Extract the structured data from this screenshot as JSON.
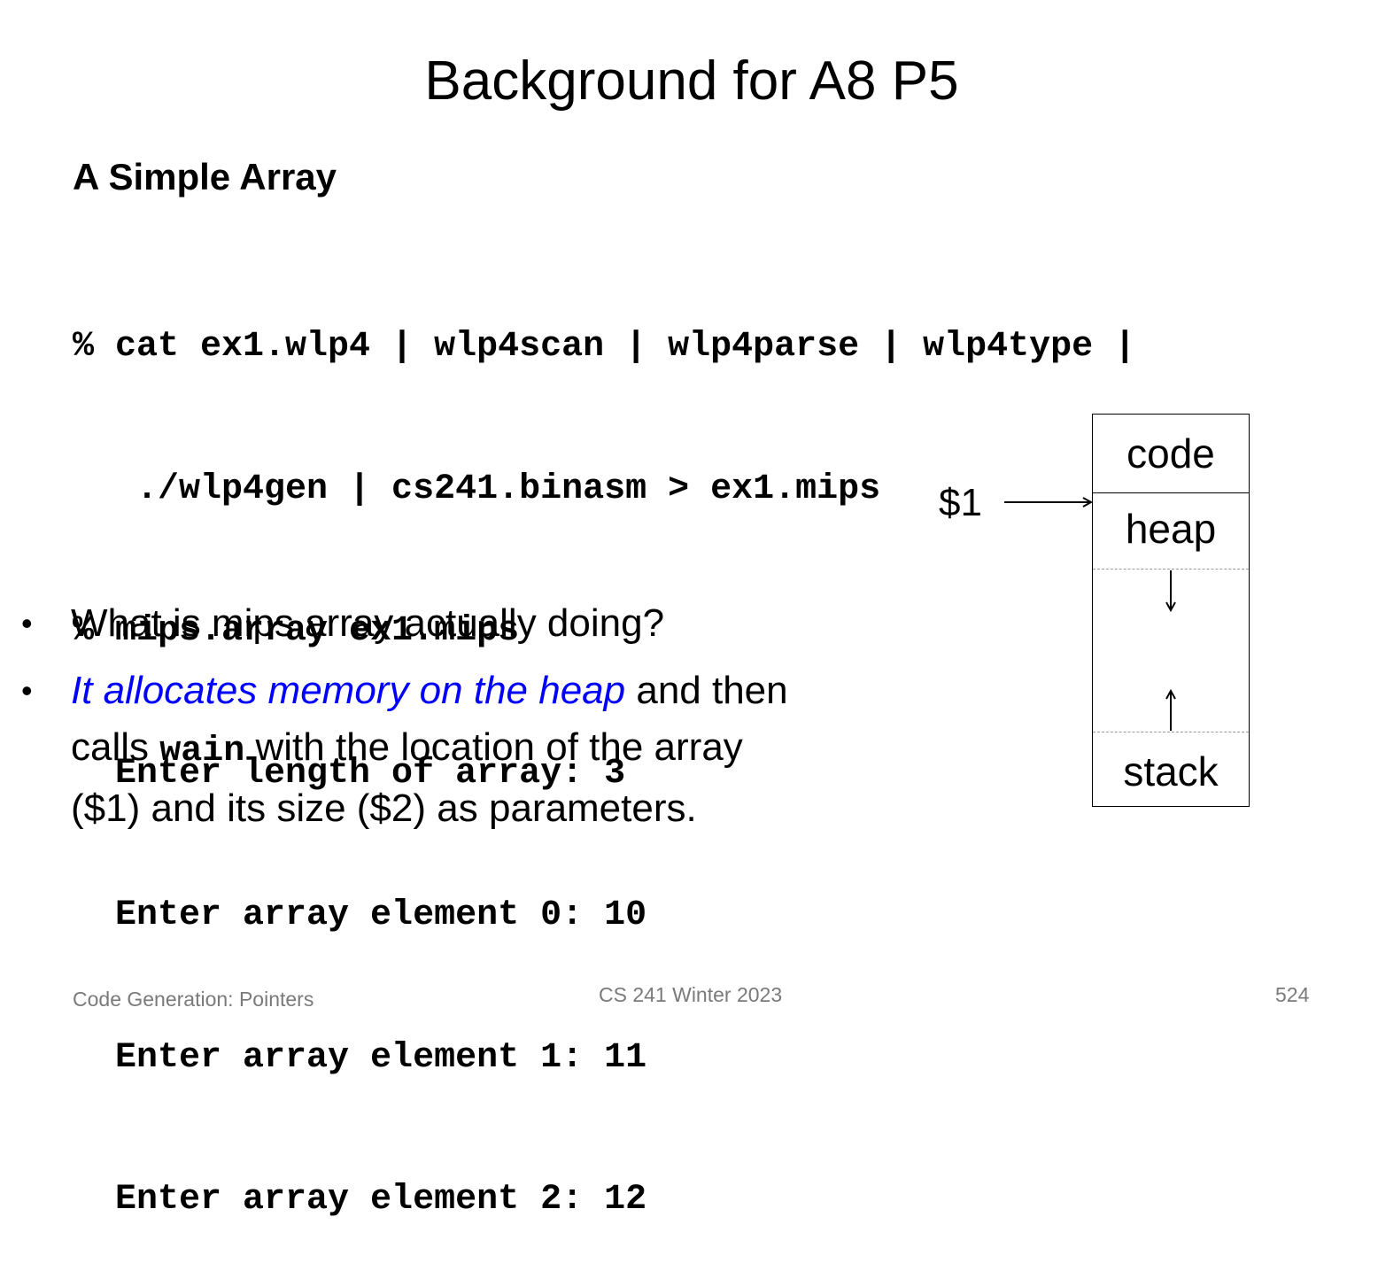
{
  "slide": {
    "title": "Background for A8 P5",
    "subtitle": "A Simple Array"
  },
  "code_lines": [
    "% cat ex1.wlp4 | wlp4scan | wlp4parse | wlp4type |",
    "   ./wlp4gen | cs241.binasm > ex1.mips",
    "% mips.array ex1.mips",
    "  Enter length of array: 3",
    "  Enter array element 0: 10",
    "  Enter array element 1: 11",
    "  Enter array element 2: 12"
  ],
  "bullets": {
    "b1": "What is mips.array actually doing?",
    "b2_highlight": "It allocates memory on the heap",
    "b2_part1": " and then calls ",
    "b2_code": "wain",
    "b2_part2": " with the location of the array ($1) and its size ($2) as parameters."
  },
  "diagram": {
    "pointer_label": "$1",
    "segments": [
      "code",
      "heap",
      "stack"
    ]
  },
  "footer": {
    "left": "Code Generation: Pointers",
    "center": "CS 241 Winter 2023",
    "right": "524"
  }
}
